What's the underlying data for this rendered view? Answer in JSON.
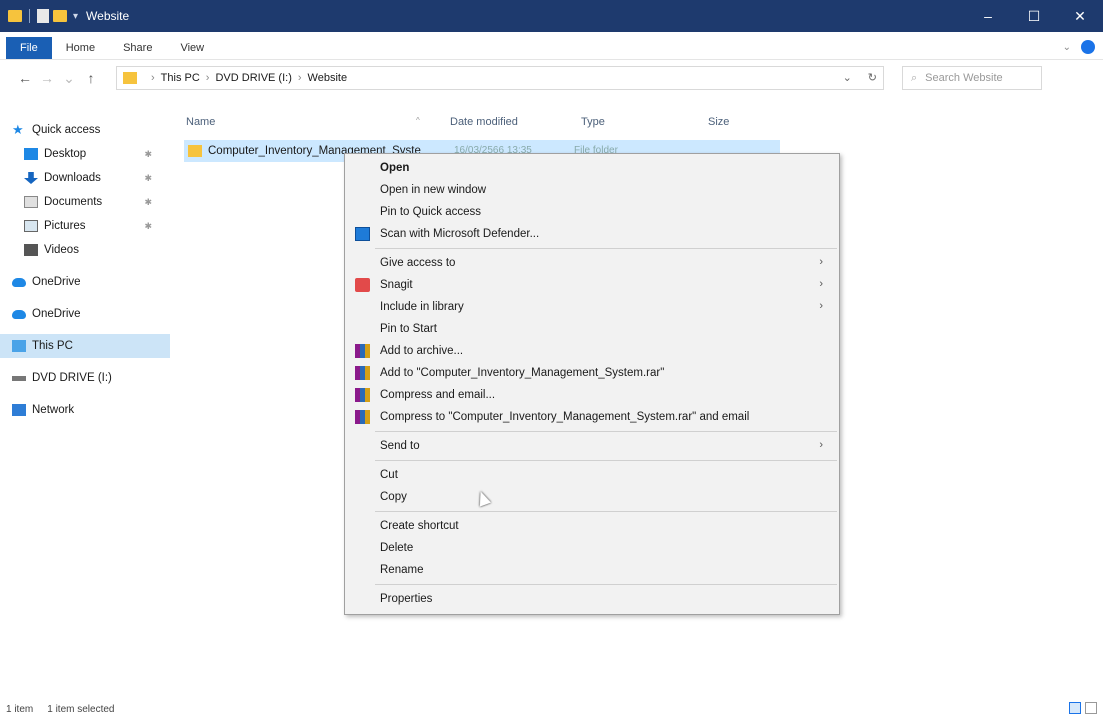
{
  "window": {
    "title": "Website",
    "controls": [
      "–",
      "☐",
      "✕"
    ]
  },
  "ribbon": {
    "tabs": [
      "File",
      "Home",
      "Share",
      "View"
    ]
  },
  "address": {
    "crumbs": [
      "This PC",
      "DVD DRIVE (I:)",
      "Website"
    ],
    "separator": "›",
    "dropdown": "⌄",
    "refresh": "↻"
  },
  "search": {
    "placeholder": "Search Website"
  },
  "sidebar": {
    "quick_access": "Quick access",
    "items": [
      {
        "label": "Desktop",
        "pinned": true
      },
      {
        "label": "Downloads",
        "pinned": true
      },
      {
        "label": "Documents",
        "pinned": true
      },
      {
        "label": "Pictures",
        "pinned": true
      },
      {
        "label": "Videos",
        "pinned": false
      }
    ],
    "onedrive1": "OneDrive",
    "onedrive2": "OneDrive",
    "this_pc": "This PC",
    "dvd": "DVD DRIVE (I:)",
    "network": "Network"
  },
  "columns": {
    "name": "Name",
    "date": "Date modified",
    "type": "Type",
    "size": "Size"
  },
  "files": [
    {
      "name": "Computer_Inventory_Management_Syste",
      "date": "16/03/2566 13:35",
      "type": "File folder"
    }
  ],
  "context_menu": {
    "open": "Open",
    "open_new_window": "Open in new window",
    "pin_quick": "Pin to Quick access",
    "scan": "Scan with Microsoft Defender...",
    "give_access": "Give access to",
    "snagit": "Snagit",
    "include_library": "Include in library",
    "pin_start": "Pin to Start",
    "add_archive": "Add to archive...",
    "add_rar": "Add to \"Computer_Inventory_Management_System.rar\"",
    "compress_email": "Compress and email...",
    "compress_rar_email": "Compress to \"Computer_Inventory_Management_System.rar\" and email",
    "send_to": "Send to",
    "cut": "Cut",
    "copy": "Copy",
    "create_shortcut": "Create shortcut",
    "delete": "Delete",
    "rename": "Rename",
    "properties": "Properties"
  },
  "status": {
    "count": "1 item",
    "selected": "1 item selected"
  }
}
